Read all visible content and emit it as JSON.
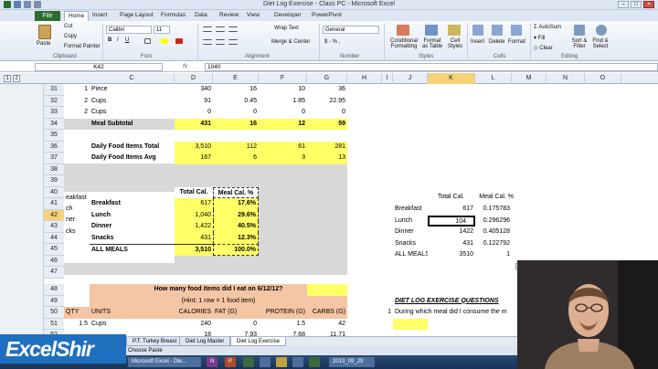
{
  "window": {
    "title": "Diet Log Exercise - Class PC  -  Microsoft Excel"
  },
  "ribbon": {
    "file_tab": "File",
    "tabs": [
      "Home",
      "Insert",
      "Page Layout",
      "Formulas",
      "Data",
      "Review",
      "View",
      "Developer",
      "PowerPivot"
    ],
    "clipboard": {
      "paste": "Paste",
      "cut": "Cut",
      "copy": "Copy",
      "format_painter": "Format Painter",
      "label": "Clipboard"
    },
    "font": {
      "name": "Calibri",
      "size": "11",
      "label": "Font"
    },
    "alignment": {
      "wrap": "Wrap Text",
      "merge": "Merge & Center",
      "label": "Alignment"
    },
    "number": {
      "format": "General",
      "label": "Number"
    },
    "styles": {
      "conditional": "Conditional Formatting",
      "format_table": "Format as Table",
      "cell_styles": "Cell Styles",
      "label": "Styles"
    },
    "cells": {
      "insert": "Insert",
      "delete": "Delete",
      "format": "Format",
      "label": "Cells"
    },
    "editing": {
      "autosum": "AutoSum",
      "fill": "Fill",
      "clear": "Clear",
      "sort": "Sort & Filter",
      "find": "Find & Select",
      "label": "Editing"
    }
  },
  "formula_bar": {
    "name_box": "K42",
    "fx": "fx",
    "value": "1040"
  },
  "columns": [
    "C",
    "D",
    "E",
    "F",
    "G",
    "H",
    "I",
    "J",
    "K",
    "L",
    "M",
    "N",
    "O"
  ],
  "outline_levels": [
    "1",
    "2"
  ],
  "rows": {
    "r31": {
      "num": "31",
      "b": "1",
      "c": "Piece",
      "d": "340",
      "e": "16",
      "f": "10",
      "g": "36"
    },
    "r32": {
      "num": "32",
      "b": "2",
      "c": "Cups",
      "d": "91",
      "e": "0.45",
      "f": "1.85",
      "g": "22.95"
    },
    "r33": {
      "num": "33",
      "b": "2",
      "c": "Cups",
      "d": "0",
      "e": "0",
      "f": "0",
      "g": "0"
    },
    "r34": {
      "num": "34",
      "c": "Meal Subtotal",
      "d": "431",
      "e": "16",
      "f": "12",
      "g": "59"
    },
    "r35": {
      "num": "35"
    },
    "r36": {
      "num": "36",
      "c": "Daily Food Items Total",
      "d": "3,510",
      "e": "112",
      "f": "61",
      "g": "281"
    },
    "r37": {
      "num": "37",
      "c": "Daily Food Items Avg",
      "d": "167",
      "e": "6",
      "f": "3",
      "g": "13"
    },
    "r38": {
      "num": "38"
    },
    "r39": {
      "num": "39"
    },
    "r40": {
      "num": "40",
      "a": "eakfast",
      "d": "Total Cal.",
      "e": "Meal Cal. %",
      "k": "Total Cal.",
      "l": "Meal Cal. %"
    },
    "r41": {
      "num": "41",
      "a": "ch",
      "c": "Breakfast",
      "d": "617",
      "e": "17.6%",
      "j": "Breakfast",
      "k": "617",
      "l": "0.175783"
    },
    "r42": {
      "num": "42",
      "a": "ner",
      "c": "Lunch",
      "d": "1,040",
      "e": "29.6%",
      "j": "Lunch",
      "k": "104",
      "l": "0.296296"
    },
    "r43": {
      "num": "43",
      "a": "cks",
      "c": "Dinner",
      "d": "1,422",
      "e": "40.5%",
      "j": "Dinner",
      "k": "1422",
      "l": "0.405128"
    },
    "r44": {
      "num": "44",
      "c": "Snacks",
      "d": "431",
      "e": "12.3%",
      "j": "Snacks",
      "k": "431",
      "l": "0.122792"
    },
    "r45": {
      "num": "45",
      "c": "ALL MEALS",
      "d": "3,510",
      "e": "100.0%",
      "j": "ALL MEALS",
      "k": "3510",
      "l": "1"
    },
    "r46": {
      "num": "46"
    },
    "r47": {
      "num": "47"
    },
    "r48": {
      "num": "48",
      "question": "How many food items did I eat on 6/12/12?"
    },
    "r49": {
      "num": "49",
      "hint": "(Hint: 1 row = 1 food item)",
      "j": "DIET LOG EXERCISE QUESTIONS"
    },
    "r50": {
      "num": "50",
      "a": "QTY",
      "b": "UNITS",
      "d": "CALORIES",
      "e": "FAT (G)",
      "f": "PROTEIN (G)",
      "g": "CARBS (G)",
      "i": "1",
      "j": "During which meal did I consume the m"
    },
    "r51": {
      "num": "51",
      "a": "1.5",
      "b": "Cups",
      "d": "240",
      "e": "0",
      "f": "1.5",
      "g": "42"
    },
    "r52": {
      "num": "52",
      "d": "18",
      "e": "7.93",
      "f": "7.68",
      "g": "11.71"
    }
  },
  "sheet_tabs": [
    "P.T. Turkey Breast",
    "Diet Log Master",
    "Diet Log Exercise"
  ],
  "status": {
    "mode": "Choose Paste"
  },
  "taskbar": {
    "items": [
      "Microsoft Excel - Die...",
      "N",
      "P",
      "2013_09_29"
    ]
  },
  "brand": {
    "text": "ExcelShir"
  },
  "colors": {
    "highlight": "#ffff66",
    "gray_block": "#d8d8d8",
    "file_tab": "#2a6d2e",
    "brand": "#1f6fbf"
  }
}
